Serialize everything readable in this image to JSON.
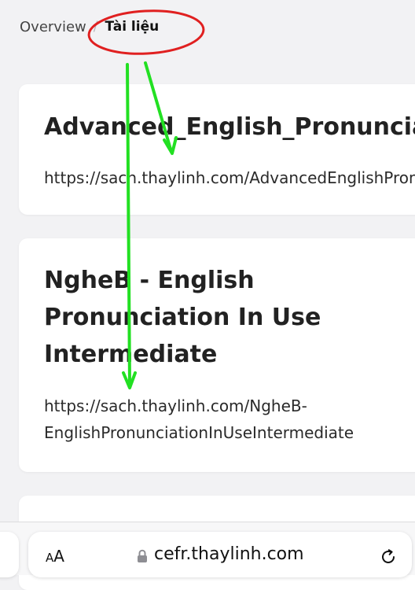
{
  "breadcrumb": {
    "items": [
      "Overview"
    ],
    "separator": "/",
    "current": "Tài liệu"
  },
  "documents": [
    {
      "title": "Advanced_English_Pronunciation",
      "url": "https://sach.thaylinh.com/AdvancedEnglishPronunciation"
    },
    {
      "title": "NgheB - English Pronunciation In Use Intermediate",
      "url": "https://sach.thaylinh.com/NgheB-EnglishPronunciationInUseIntermediate"
    }
  ],
  "browser": {
    "text_size_label_small": "A",
    "text_size_label_large": "A",
    "address": "cefr.thaylinh.com",
    "lock_icon": "lock-icon",
    "reload_icon": "reload-icon"
  },
  "colors": {
    "annotation_circle": "#e02020",
    "annotation_arrow": "#22e022",
    "page_background": "#f2f2f4",
    "card_background": "#ffffff"
  }
}
